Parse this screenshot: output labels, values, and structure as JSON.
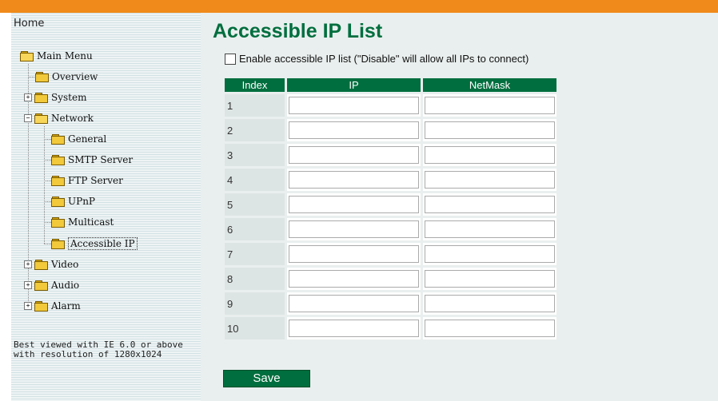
{
  "sidebar": {
    "home": "Home",
    "main_menu": "Main Menu",
    "items": {
      "overview": "Overview",
      "system": "System",
      "network": "Network",
      "general": "General",
      "smtp": "SMTP Server",
      "ftp": "FTP Server",
      "upnp": "UPnP",
      "multicast": "Multicast",
      "accessible_ip": "Accessible IP",
      "video": "Video",
      "audio": "Audio",
      "alarm": "Alarm"
    },
    "best_viewed": "Best viewed with IE 6.0 or above with resolution of 1280x1024"
  },
  "main": {
    "title": "Accessible IP List",
    "enable_label": "Enable accessible IP list (\"Disable\" will allow all IPs to connect)",
    "enable_checked": false,
    "headers": {
      "index": "Index",
      "ip": "IP",
      "netmask": "NetMask"
    },
    "rows": [
      {
        "index": "1",
        "ip": "",
        "netmask": ""
      },
      {
        "index": "2",
        "ip": "",
        "netmask": ""
      },
      {
        "index": "3",
        "ip": "",
        "netmask": ""
      },
      {
        "index": "4",
        "ip": "",
        "netmask": ""
      },
      {
        "index": "5",
        "ip": "",
        "netmask": ""
      },
      {
        "index": "6",
        "ip": "",
        "netmask": ""
      },
      {
        "index": "7",
        "ip": "",
        "netmask": ""
      },
      {
        "index": "8",
        "ip": "",
        "netmask": ""
      },
      {
        "index": "9",
        "ip": "",
        "netmask": ""
      },
      {
        "index": "10",
        "ip": "",
        "netmask": ""
      }
    ],
    "save_label": "Save"
  },
  "colors": {
    "accent_orange": "#f08a1a",
    "brand_green": "#006e3e"
  }
}
